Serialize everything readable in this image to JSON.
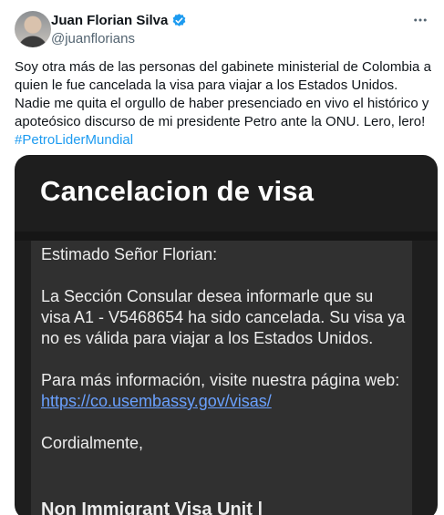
{
  "author": {
    "display_name": "Juan Florian Silva",
    "handle": "@juanflorians",
    "verified": true
  },
  "tweet": {
    "text": "Soy otra más de las personas del gabinete ministerial de Colombia a quien le fue cancelada la visa para viajar a los Estados Unidos. Nadie me quita el orgullo de haber presenciado en vivo el histórico y apoteósico discurso de mi presidente Petro ante la ONU. Lero, lero!",
    "hashtag": "#PetroLiderMundial"
  },
  "media": {
    "title": "Cancelacion de visa",
    "greeting": "Estimado Señor Florian:",
    "body": "La Sección Consular desea informarle que su visa A1 - V5468654 ha sido cancelada. Su visa ya no es válida para viajar a los Estados Unidos.",
    "info_prefix": "Para más información, visite nuestra página web: ",
    "link": "https://co.usembassy.gov/visas/",
    "closing": "Cordialmente,",
    "signature": "Non Immigrant Visa Unit |"
  },
  "icons": {
    "verified": "verified-badge-icon",
    "more": "more-horizontal-icon"
  },
  "colors": {
    "accent": "#1d9bf0",
    "media_bg": "#1e1e1e",
    "link": "#6aa1ff"
  }
}
